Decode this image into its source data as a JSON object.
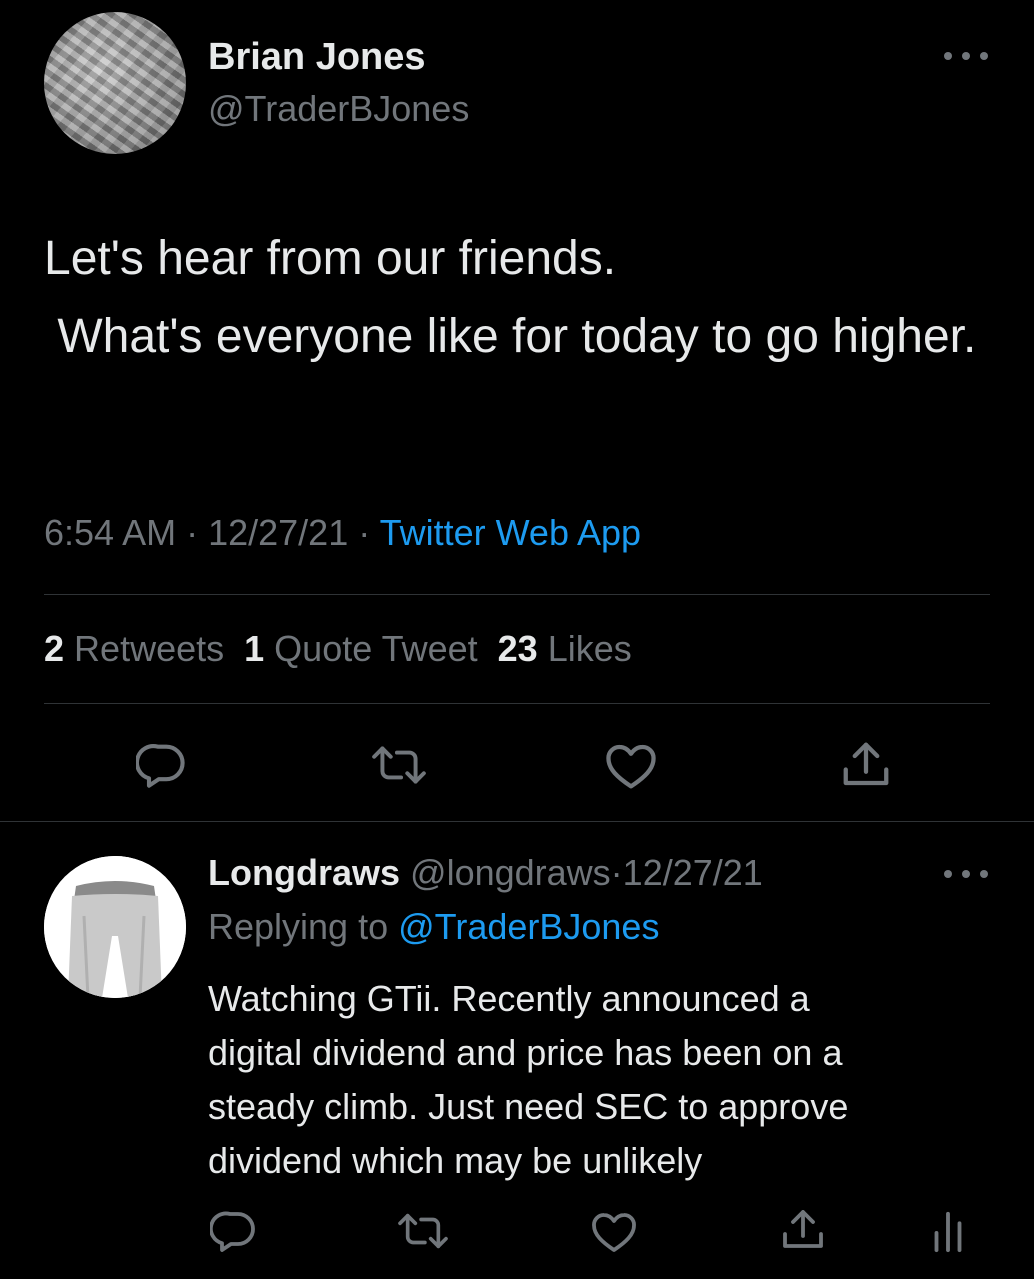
{
  "tweet": {
    "author_name": "Brian Jones",
    "author_handle": "@TraderBJones",
    "text": "Let's hear from our friends.\n What's everyone like for today to go higher.",
    "time": "6:54 AM",
    "date": "12/27/21",
    "separator": " · ",
    "source": "Twitter Web App",
    "stats": {
      "retweets_count": "2",
      "retweets_label": "Retweets",
      "quotes_count": "1",
      "quotes_label": "Quote Tweet",
      "likes_count": "23",
      "likes_label": "Likes"
    }
  },
  "reply": {
    "author_name": "Longdraws",
    "author_handle": "@longdraws",
    "separator": "·",
    "date": "12/27/21",
    "replying_prefix": "Replying to",
    "replying_to": "@TraderBJones",
    "text": "Watching GTii. Recently announced a\ndigital dividend and price has been on a\nsteady climb. Just need SEC to approve\ndividend which may be unlikely"
  },
  "icons": [
    "reply-icon",
    "retweet-icon",
    "like-icon",
    "share-icon",
    "analytics-icon",
    "more-icon"
  ],
  "colors": {
    "background": "#000000",
    "text": "#e7e9ea",
    "secondary": "#71767b",
    "link": "#1d9bf0",
    "divider": "#2f3336"
  }
}
